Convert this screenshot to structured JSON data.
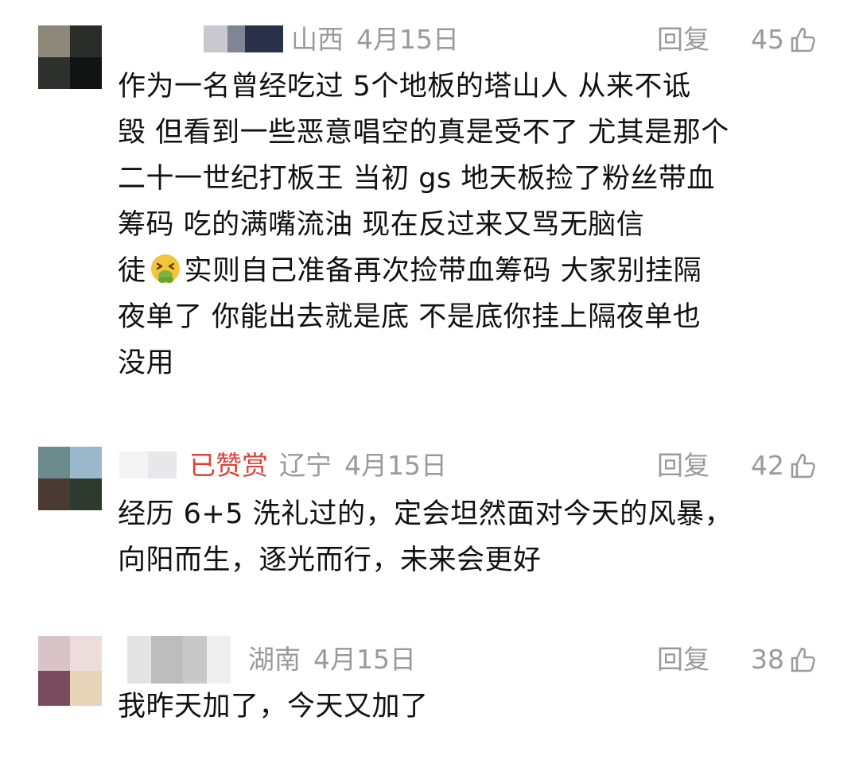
{
  "comments": [
    {
      "region": "山西",
      "date": "4月15日",
      "badge": "",
      "reply_label": "回复",
      "likes": "45",
      "lines": [
        "作为一名曾经吃过 5个地板的塔山人 从来不诋",
        "毁 但看到一些恶意唱空的真是受不了  尤其是那个",
        "二十一世纪打板王  当初 gs 地天板捡了粉丝带血",
        "筹码  吃的满嘴流油  现在反过来又骂无脑信",
        "实则自己准备再次捡带血筹码 大家别挂隔",
        "夜单了  你能出去就是底  不是底你挂上隔夜单也",
        "没用"
      ],
      "line5_prefix": "徒",
      "emoji_name": "nauseated-face-icon"
    },
    {
      "region": "辽宁",
      "date": "4月15日",
      "badge": "已赞赏",
      "reply_label": "回复",
      "likes": "42",
      "lines": [
        "经历 6+5 洗礼过的，定会坦然面对今天的风暴，",
        "向阳而生，逐光而行，未来会更好"
      ]
    },
    {
      "region": "湖南",
      "date": "4月15日",
      "badge": "",
      "reply_label": "回复",
      "likes": "38",
      "lines": [
        "我昨天加了，今天又加了"
      ]
    }
  ],
  "colors": {
    "meta_gray": "#9a9a9a",
    "badge_red": "#e0413a",
    "text": "#111111"
  }
}
